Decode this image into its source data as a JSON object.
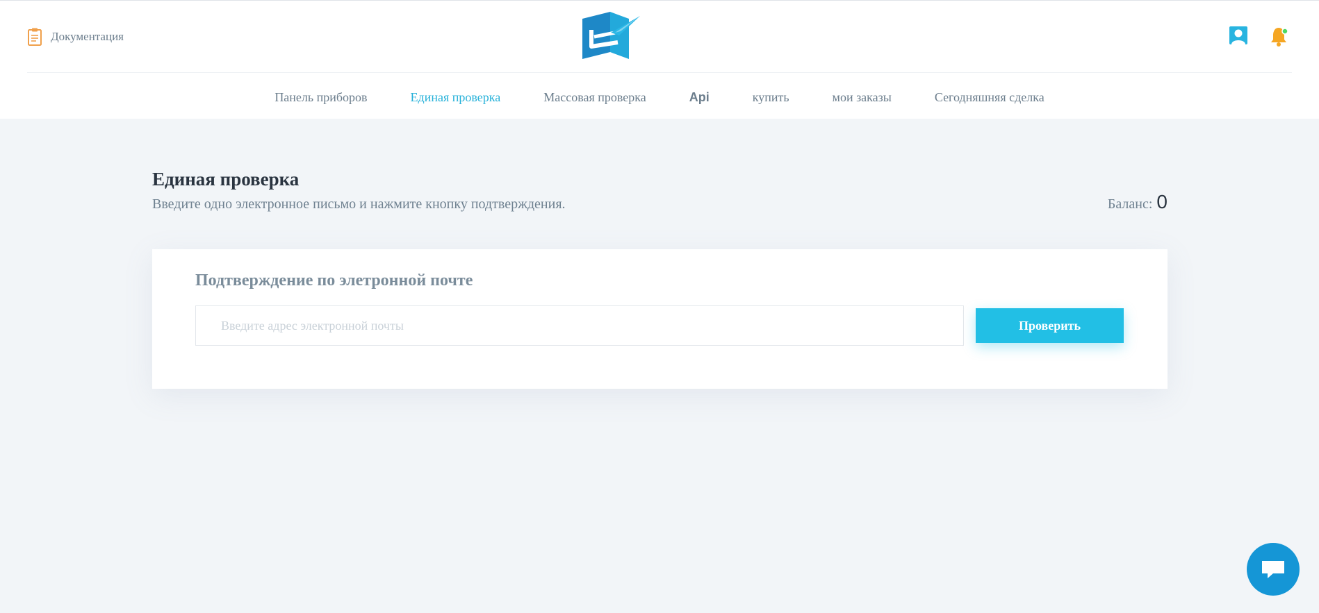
{
  "header": {
    "documentation_label": "Документация",
    "icons": {
      "documentation": "clipboard-icon",
      "logo": "logo-icon",
      "user": "user-icon",
      "notifications": "bell-icon"
    }
  },
  "nav": {
    "items": [
      {
        "label": "Панель приборов",
        "active": false
      },
      {
        "label": "Единая проверка",
        "active": true
      },
      {
        "label": "Массовая проверка",
        "active": false
      },
      {
        "label": "Api",
        "active": false
      },
      {
        "label": "купить",
        "active": false
      },
      {
        "label": "мои заказы",
        "active": false
      },
      {
        "label": "Сегодняшняя сделка",
        "active": false
      }
    ]
  },
  "page": {
    "title": "Единая проверка",
    "subtitle": "Введите одно электронное письмо и нажмите кнопку подтверждения.",
    "balance_label": "Баланс:",
    "balance_value": "0"
  },
  "card": {
    "title": "Подтверждение по элетронной почте",
    "email_placeholder": "Введите адрес электронной почты",
    "email_value": "",
    "check_button_label": "Проверить"
  },
  "chat": {
    "icon": "chat-icon"
  },
  "colors": {
    "accent": "#26b1d9",
    "button": "#22bfe5",
    "chat": "#1596d6",
    "background": "#f2f5f8",
    "notification_dot": "#4cd964",
    "bell": "#f5a623"
  }
}
